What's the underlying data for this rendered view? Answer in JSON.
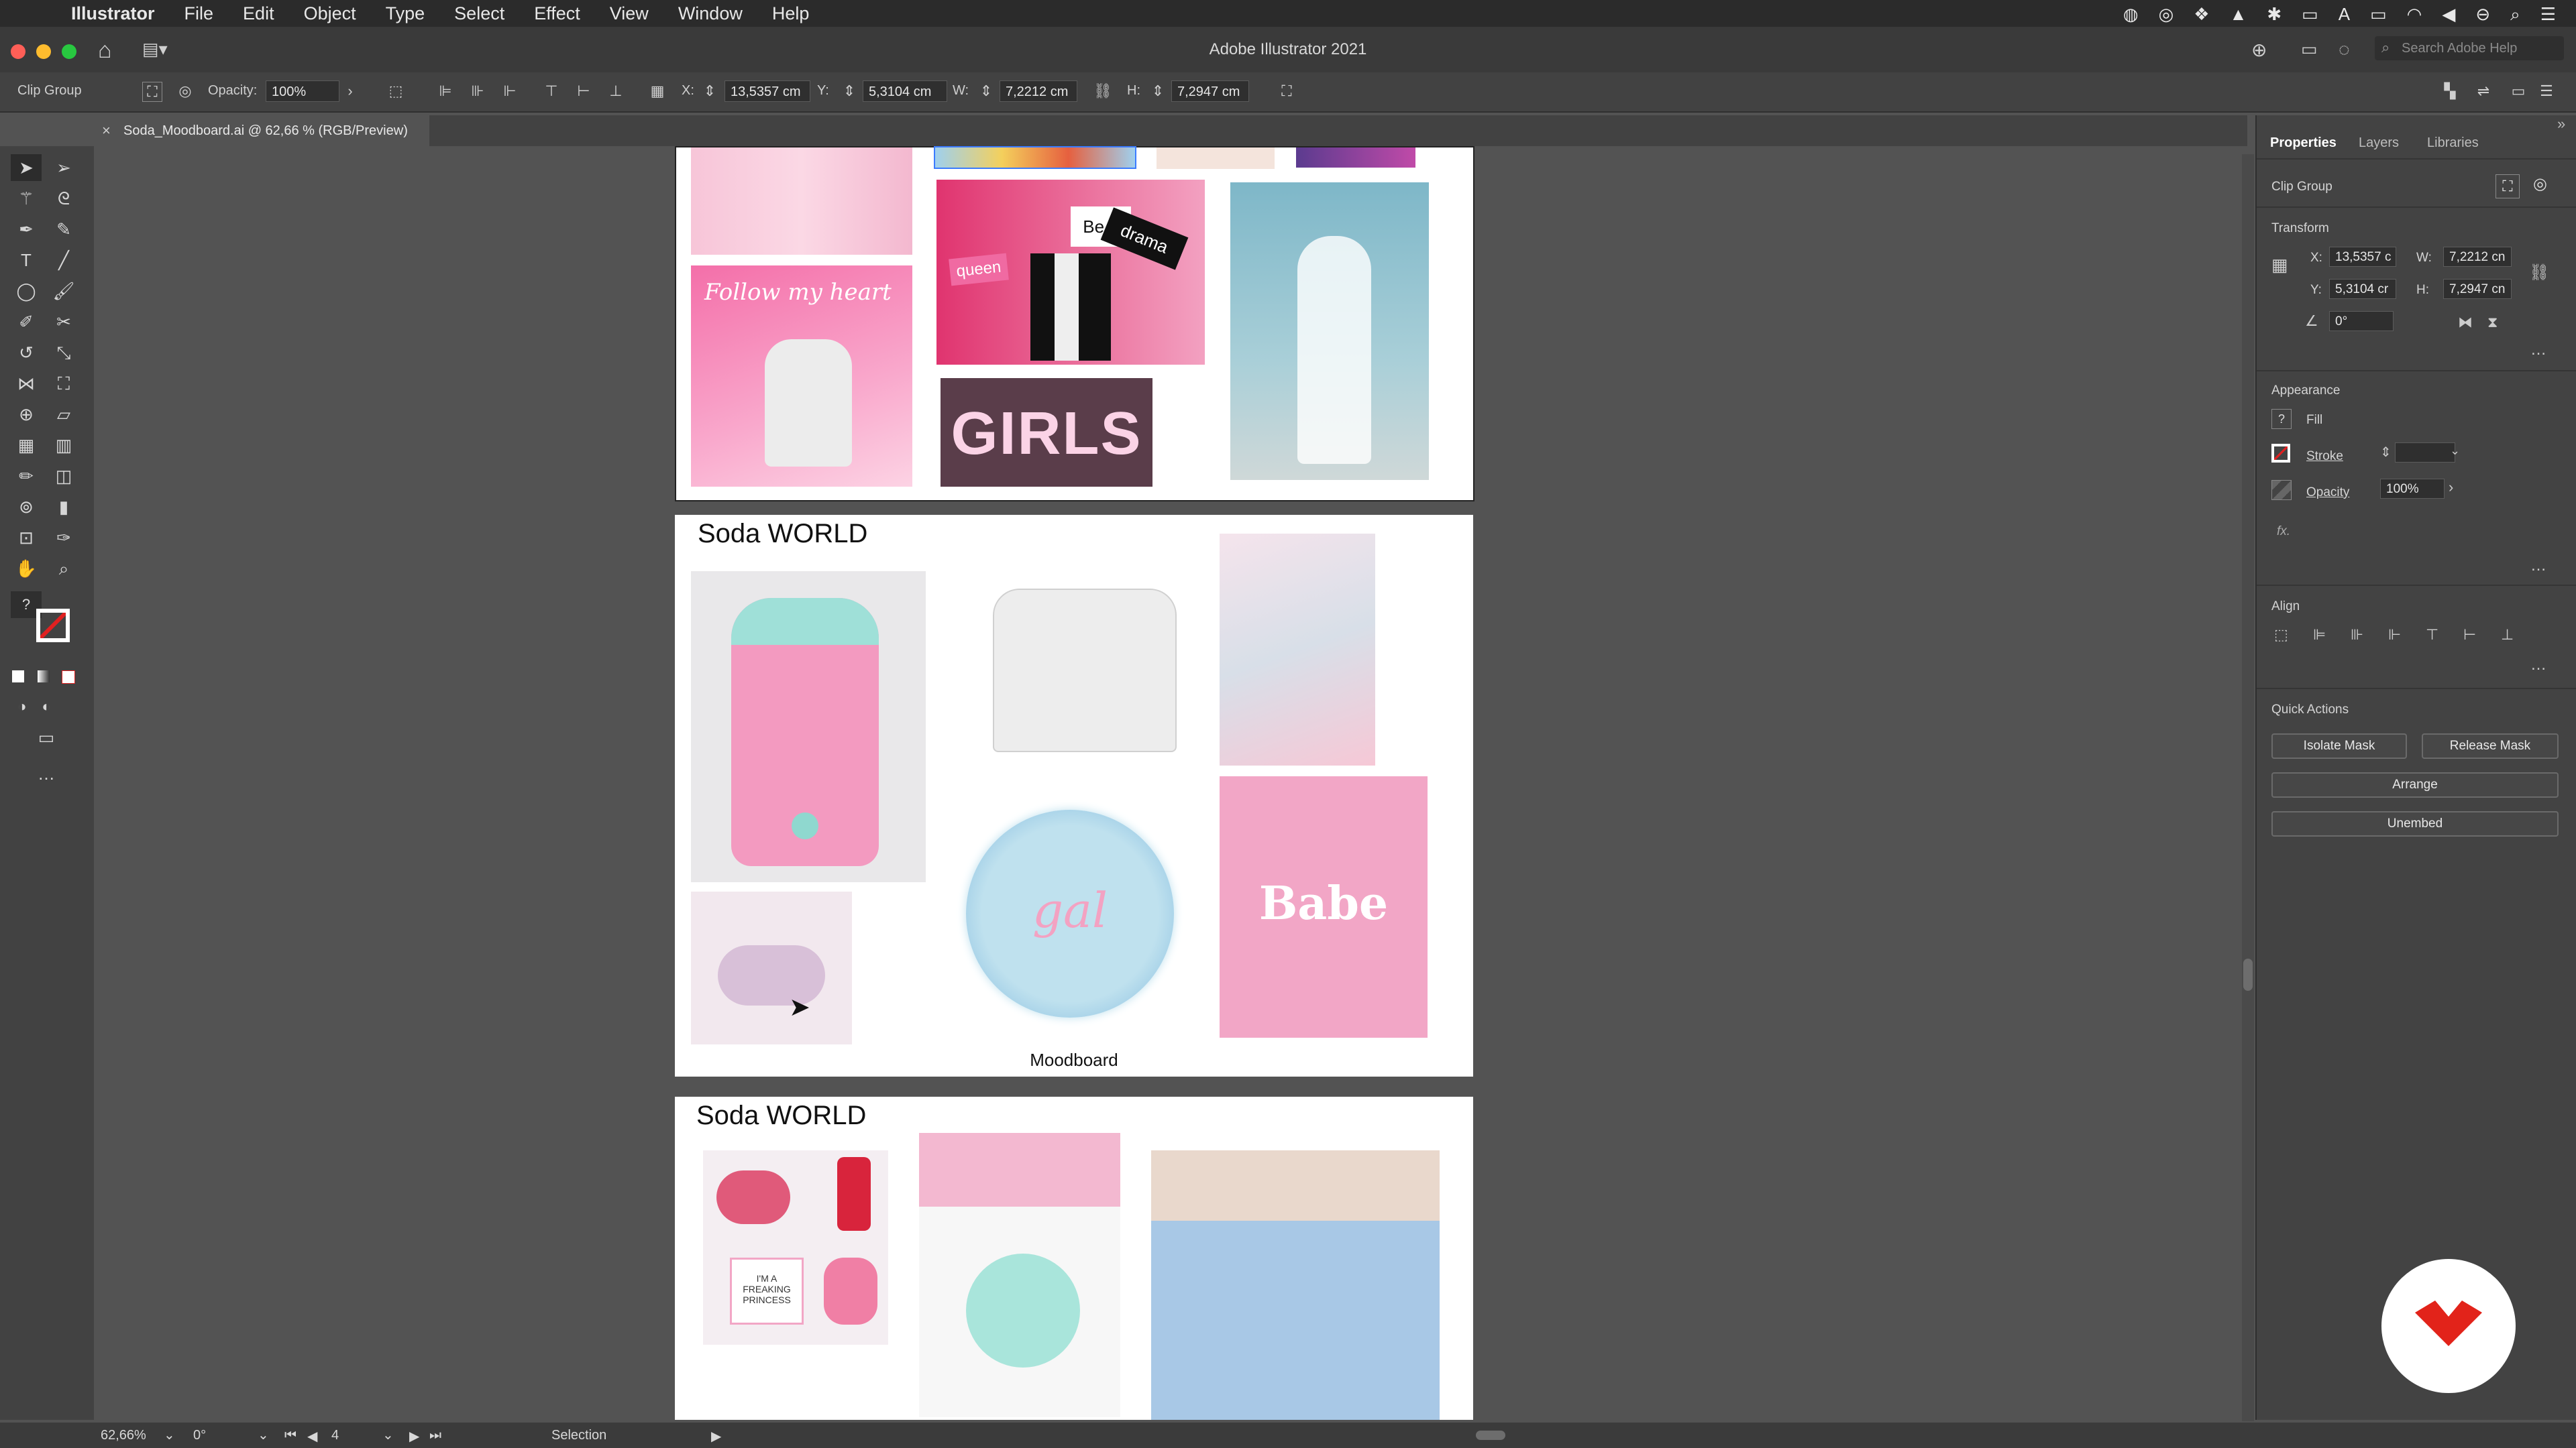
{
  "menubar": {
    "app_name": "Illustrator",
    "items": [
      "File",
      "Edit",
      "Object",
      "Type",
      "Select",
      "Effect",
      "View",
      "Window",
      "Help"
    ]
  },
  "window": {
    "title": "Adobe Illustrator 2021",
    "search_placeholder": "Search Adobe Help"
  },
  "control_bar": {
    "selection_type": "Clip Group",
    "opacity_label": "Opacity:",
    "opacity_value": "100%",
    "x_label": "X:",
    "x_value": "13,5357 cm",
    "y_label": "Y:",
    "y_value": "5,3104 cm",
    "w_label": "W:",
    "w_value": "7,2212 cm",
    "h_label": "H:",
    "h_value": "7,2947 cm"
  },
  "document_tab": {
    "label": "Soda_Moodboard.ai @ 62,66 % (RGB/Preview)"
  },
  "artboards": {
    "a2_title": "Soda WORLD",
    "a2_caption": "Moodboard",
    "a3_title": "Soda WORLD",
    "image_texts": {
      "neon1": "Follow my heart",
      "sign1": "queen",
      "sign2": "Be a",
      "sign3": "drama",
      "girls": "GIRLS",
      "gal": "gal",
      "babe": "Babe",
      "princess": "I'M A FREAKING PRINCESS"
    }
  },
  "properties_panel": {
    "tabs": [
      "Properties",
      "Layers",
      "Libraries"
    ],
    "selection": "Clip Group",
    "transform": {
      "heading": "Transform",
      "x_label": "X:",
      "x_value": "13,5357 c",
      "y_label": "Y:",
      "y_value": "5,3104 cr",
      "w_label": "W:",
      "w_value": "7,2212 cn",
      "h_label": "H:",
      "h_value": "7,2947 cn",
      "angle_value": "0°"
    },
    "appearance": {
      "heading": "Appearance",
      "fill_label": "Fill",
      "stroke_label": "Stroke",
      "opacity_label": "Opacity",
      "opacity_value": "100%",
      "fx_label": "fx."
    },
    "align": {
      "heading": "Align"
    },
    "quick_actions": {
      "heading": "Quick Actions",
      "isolate_mask": "Isolate Mask",
      "release_mask": "Release Mask",
      "arrange": "Arrange",
      "unembed": "Unembed"
    }
  },
  "status_bar": {
    "zoom": "62,66%",
    "rotation": "0°",
    "artboard_number": "4",
    "tool_name": "Selection"
  },
  "colors": {
    "accent_pink": "#f2a6c6",
    "accent_blue": "#9ccbe6",
    "brand_red": "#e2231a"
  }
}
